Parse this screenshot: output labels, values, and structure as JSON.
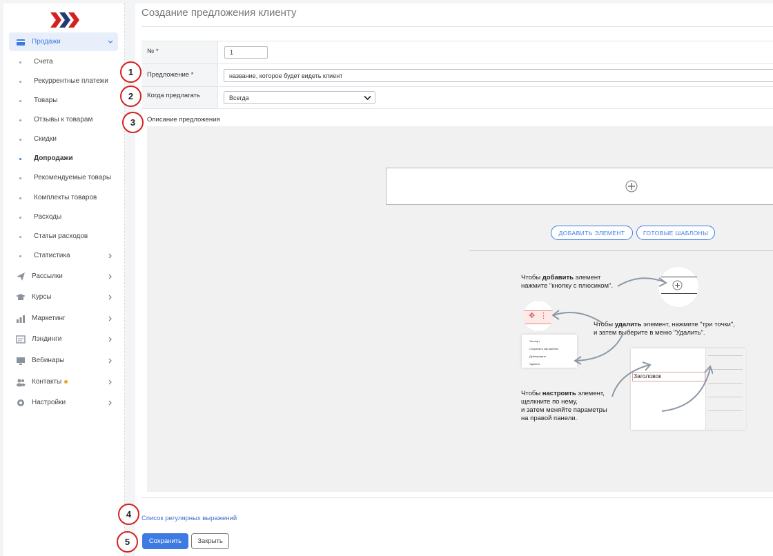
{
  "sidebar": {
    "section_active": {
      "label": "Продажи",
      "icon": "card-icon"
    },
    "sub_items": [
      {
        "label": "Счета"
      },
      {
        "label": "Рекуррентные платежи"
      },
      {
        "label": "Товары"
      },
      {
        "label": "Отзывы к товарам"
      },
      {
        "label": "Скидки"
      },
      {
        "label": "Допродажи"
      },
      {
        "label": "Рекомендуемые товары"
      },
      {
        "label": "Комплекты товаров"
      },
      {
        "label": "Расходы"
      },
      {
        "label": "Статьи расходов"
      },
      {
        "label": "Статистика"
      }
    ],
    "sections": [
      {
        "label": "Рассылки",
        "icon": "paper-plane-icon"
      },
      {
        "label": "Курсы",
        "icon": "graduation-cap-icon"
      },
      {
        "label": "Маркетинг",
        "icon": "bar-chart-icon"
      },
      {
        "label": "Лэндинги",
        "icon": "landing-page-icon"
      },
      {
        "label": "Вебинары",
        "icon": "monitor-icon"
      },
      {
        "label": "Контакты",
        "icon": "users-icon"
      },
      {
        "label": "Настройки",
        "icon": "gear-icon"
      }
    ]
  },
  "page": {
    "title": "Создание предложения клиенту"
  },
  "form": {
    "number_label": "№ *",
    "number_value": "1",
    "offer_label": "Предложение *",
    "offer_value": "название, которое будет видеть клиент",
    "when_label": "Когда предлагать",
    "when_value": "Всегда",
    "description_label": "Описание предложения"
  },
  "editor": {
    "add_element_label": "ДОБАВИТЬ ЭЛЕМЕНТ",
    "templates_label": "ГОТОВЫЕ ШАБЛОНЫ",
    "hint_add_pre": "Чтобы ",
    "hint_add_bold": "добавить",
    "hint_add_post": " элемент",
    "hint_add_line2": "нажмите \"кнопку с плюсиком\".",
    "hint_delete_pre": "Чтобы ",
    "hint_delete_bold": "удалить",
    "hint_delete_post": " элемент, нажмите \"три точки\",",
    "hint_delete_line2": "и затем выберите в меню \"Удалить\".",
    "hint_config_pre": "Чтобы ",
    "hint_config_bold": "настроить",
    "hint_config_post": " элемент,",
    "hint_config_line2": "щелкните по нему,",
    "hint_config_line3": "и затем меняйте параметры",
    "hint_config_line4": "на правой панели.",
    "illus_heading": "Заголовок",
    "menu_items": [
      "Экспорт",
      "Сохранить как шаблон",
      "Дублировать",
      "Удалить"
    ]
  },
  "footer": {
    "regex_link": "Список регулярных выражений",
    "save_label": "Сохранить",
    "close_label": "Закрыть"
  },
  "badges": [
    "1",
    "2",
    "3",
    "4",
    "5"
  ],
  "colors": {
    "accent": "#3d7be3",
    "badge_border": "#d6201f",
    "logo_red": "#d6201f",
    "logo_navy": "#1f3b70"
  }
}
